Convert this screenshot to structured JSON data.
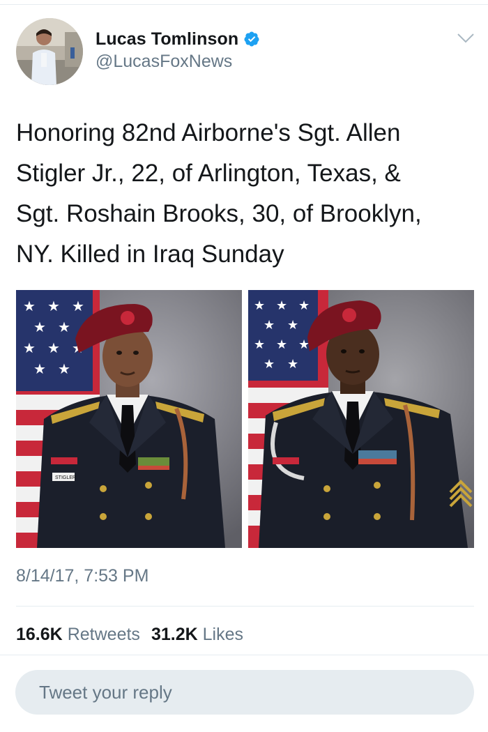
{
  "author": {
    "display_name": "Lucas Tomlinson",
    "handle": "@LucasFoxNews",
    "verified": true
  },
  "tweet": {
    "lines": [
      "Honoring 82nd Airborne's Sgt. Allen",
      "Stigler Jr., 22, of Arlington, Texas, &",
      "Sgt. Roshain Brooks, 30, of Brooklyn,",
      "NY. Killed in Iraq Sunday"
    ],
    "timestamp": "8/14/17, 7:53 PM"
  },
  "photos": [
    {
      "name_tag": "STIGLER"
    },
    {
      "name_tag": ""
    }
  ],
  "stats": {
    "retweets_count": "16.6K",
    "retweets_label": "Retweets",
    "likes_count": "31.2K",
    "likes_label": "Likes"
  },
  "reply": {
    "placeholder": "Tweet your reply"
  },
  "colors": {
    "verified_blue": "#1da1f2",
    "secondary_text": "#657786",
    "primary_text": "#14171a",
    "divider": "#e6ecf0",
    "beret_maroon": "#7a1420"
  },
  "icons": [
    "verified-badge-icon",
    "chevron-down-icon"
  ]
}
